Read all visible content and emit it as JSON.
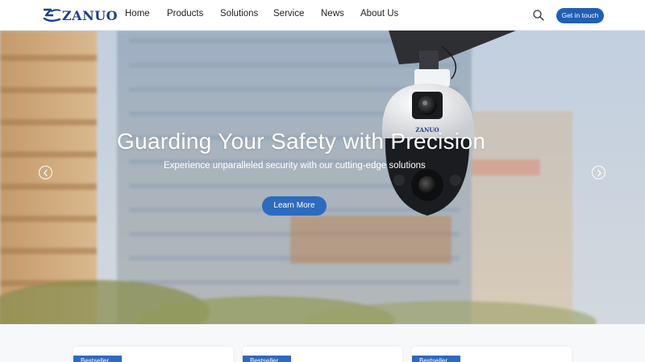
{
  "brand": {
    "name": "ZANUO"
  },
  "nav": {
    "items": [
      {
        "label": "Home"
      },
      {
        "label": "Products"
      },
      {
        "label": "Solutions"
      },
      {
        "label": "Service"
      },
      {
        "label": "News"
      },
      {
        "label": "About Us"
      }
    ],
    "search_icon": "search-icon",
    "cta_label": "Get in touch"
  },
  "hero": {
    "title": "Guarding Your Safety with Precision",
    "subtitle": "Experience unparalleled security with our cutting-edge solutions",
    "button_label": "Learn More",
    "camera_brand": "ZANUO",
    "prev_icon": "chevron-left-icon",
    "next_icon": "chevron-right-icon"
  },
  "cards": [
    {
      "badge": "Bestseller"
    },
    {
      "badge": "Bestseller"
    },
    {
      "badge": "Bestseller"
    }
  ],
  "colors": {
    "brand": "#1e3f8f",
    "accent": "#1f5fb5",
    "button": "#2c6bbf"
  }
}
